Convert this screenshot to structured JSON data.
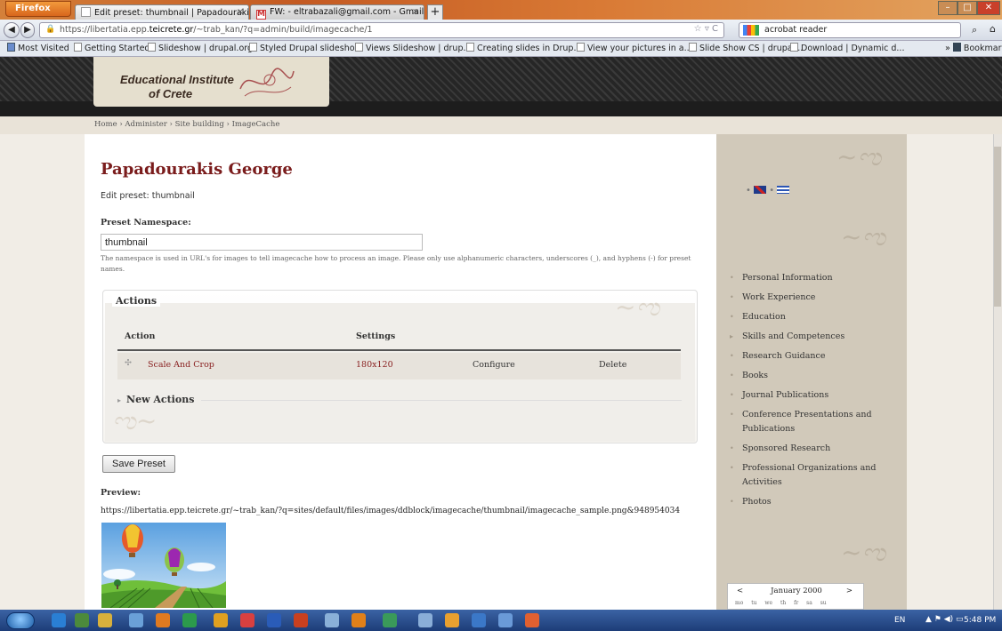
{
  "browser": {
    "app_button": "Firefox",
    "tabs": [
      {
        "label": "Edit preset: thumbnail | Papadourakis..."
      },
      {
        "label": "FW: - eltrabazali@gmail.com - Gmail"
      }
    ],
    "new_tab": "+",
    "url": {
      "pre": "https://libertatia.epp.",
      "host": "teicrete.gr",
      "post": "/~trab_kan/?q=admin/build/imagecache/1"
    },
    "search_text": "acrobat reader",
    "bookmarks": [
      "Most Visited",
      "Getting Started",
      "Slideshow | drupal.org",
      "Styled Drupal slidesho...",
      "Views Slideshow | drup...",
      "Creating slides in Drup...",
      "View your pictures in a...",
      "Slide Show CS | drupal...",
      "Download | Dynamic d..."
    ],
    "bookmarks_menu": "Bookmark"
  },
  "site": {
    "logo_line1": "Educational Institute",
    "logo_line2": "of Crete"
  },
  "breadcrumb": "Home › Administer › Site building › ImageCache",
  "main": {
    "title": "Papadourakis George",
    "subtitle": "Edit preset: thumbnail",
    "namespace_label": "Preset Namespace:",
    "namespace_value": "thumbnail",
    "namespace_help": "The namespace is used in URL's for images to tell imagecache how to process an image. Please only use alphanumeric characters, underscores (_), and hyphens (-) for preset names.",
    "actions": {
      "legend": "Actions",
      "headers": {
        "action": "Action",
        "settings": "Settings"
      },
      "rows": [
        {
          "action": "Scale And Crop",
          "settings": "180x120",
          "configure": "Configure",
          "delete": "Delete"
        }
      ],
      "new_actions": "New Actions"
    },
    "save_button": "Save Preset",
    "preview_label": "Preview:",
    "preview_url": "https://libertatia.epp.teicrete.gr/~trab_kan/?q=sites/default/files/images/ddblock/imagecache/thumbnail/imagecache_sample.png&948954034"
  },
  "sidebar": {
    "nav": [
      "Personal Information",
      "Work Experience",
      "Education",
      "Skills and Competences",
      "Research Guidance",
      "Books",
      "Journal Publications",
      "Conference Presentations and Publications",
      "Sponsored Research",
      "Professional Organizations and Activities",
      "Photos"
    ],
    "calendar": {
      "month": "January 2000",
      "prev": "<",
      "next": ">",
      "days": "mo tu we th fr sa su"
    }
  },
  "taskbar": {
    "lang": "EN",
    "time": "5:48 PM"
  },
  "colors": {
    "accent": "#7a1c1c",
    "sidebar_bg": "#d1c9ba",
    "link": "#8a2222"
  }
}
